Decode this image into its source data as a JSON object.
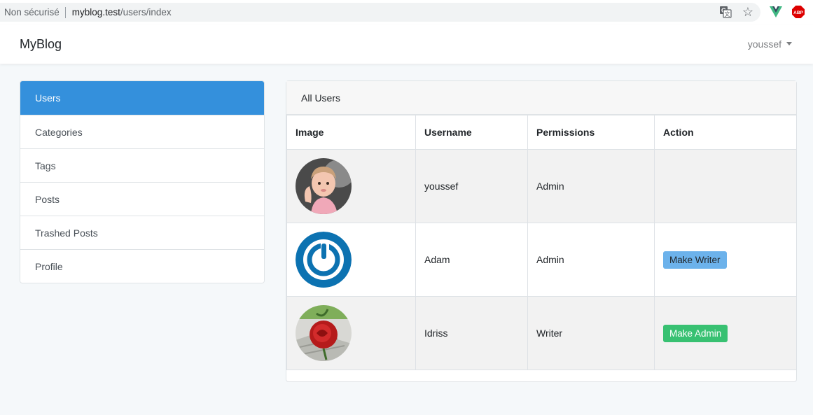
{
  "browser": {
    "insecure_label": "Non sécurisé",
    "url_host": "myblog.test",
    "url_path": "/users/index",
    "icons": [
      "translate-icon",
      "star-icon",
      "vue-devtools-icon",
      "adblock-plus-icon"
    ],
    "abp_text": "ABP"
  },
  "navbar": {
    "brand": "MyBlog",
    "user": "youssef"
  },
  "sidebar": {
    "items": [
      {
        "label": "Users",
        "active": true
      },
      {
        "label": "Categories"
      },
      {
        "label": "Tags"
      },
      {
        "label": "Posts"
      },
      {
        "label": "Trashed Posts"
      },
      {
        "label": "Profile"
      }
    ]
  },
  "card": {
    "header": "All Users",
    "columns": [
      "Image",
      "Username",
      "Permissions",
      "Action"
    ],
    "rows": [
      {
        "username": "youssef",
        "permission": "Admin",
        "action": "",
        "avatar": "baby-photo"
      },
      {
        "username": "Adam",
        "permission": "Admin",
        "action": "Make Writer",
        "avatar": "power-logo"
      },
      {
        "username": "Idriss",
        "permission": "Writer",
        "action": "Make Admin",
        "avatar": "red-rose-photo"
      }
    ]
  },
  "colors": {
    "primary": "#3490dc",
    "make_writer": "#6cb2eb",
    "make_admin": "#38c172"
  }
}
